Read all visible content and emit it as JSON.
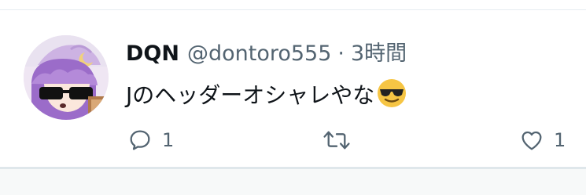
{
  "tweet": {
    "display_name": "DQN",
    "handle": "@dontoro555",
    "separator": "·",
    "time": "3時間",
    "text": "Jのヘッダーオシャレやな",
    "emoji": "smiling-face-with-sunglasses-icon"
  },
  "actions": {
    "reply_icon": "reply-icon",
    "reply_count": "1",
    "retweet_icon": "retweet-icon",
    "retweet_count": "",
    "like_icon": "heart-icon",
    "like_count": "1"
  },
  "colors": {
    "text_primary": "#0f1419",
    "text_secondary": "#536471",
    "divider": "#e6ecf0",
    "emoji_face": "#f6c544",
    "avatar_hair": "#9b6cc9"
  }
}
